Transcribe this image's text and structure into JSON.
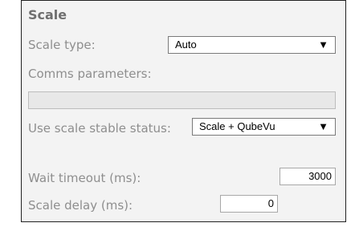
{
  "section": {
    "title": "Scale"
  },
  "fields": {
    "scale_type": {
      "label": "Scale type:",
      "value": "Auto",
      "arrow": "▼"
    },
    "comms_parameters": {
      "label": "Comms parameters:",
      "value": ""
    },
    "use_scale_stable": {
      "label": "Use scale stable status:",
      "value": "Scale + QubeVu",
      "arrow": "▼"
    },
    "wait_timeout": {
      "label": "Wait timeout (ms):",
      "value": "3000"
    },
    "scale_delay": {
      "label": "Scale delay (ms):",
      "value": "0"
    }
  }
}
